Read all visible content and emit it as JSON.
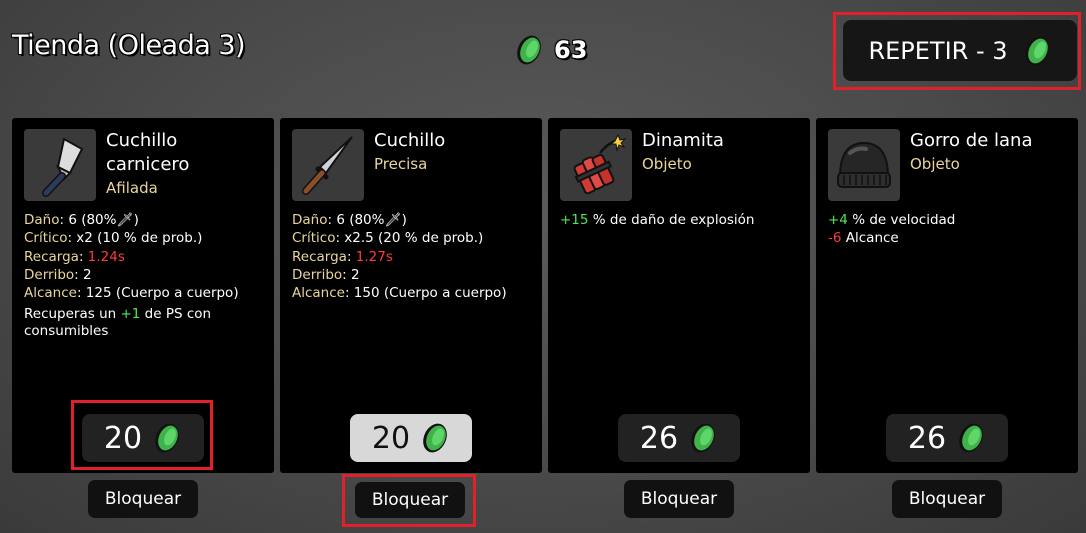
{
  "header": {
    "title": "Tienda (Oleada 3)",
    "materials": "63",
    "reroll_label": "REPETIR - 3"
  },
  "cards": [
    {
      "name": "Cuchillo carnicero",
      "tag": "Afilada",
      "icon": "cleaver-icon",
      "stats": [
        {
          "key": "Daño",
          "value": ": 6 (80%",
          "suffix": ")",
          "icon": "sword-icon"
        },
        {
          "key": "Crítico",
          "value": ": x2 (10 % de prob.)"
        },
        {
          "key": "Recarga",
          "value": ": ",
          "red": "1.24s"
        },
        {
          "key": "Derribo",
          "value": ": 2"
        },
        {
          "key": "Alcance",
          "value": ": 125 (Cuerpo a cuerpo)"
        }
      ],
      "extra_pre": "Recuperas un ",
      "extra_green": "+1",
      "extra_post": " de PS con consumibles",
      "price": "20",
      "lock_label": "Bloquear"
    },
    {
      "name": "Cuchillo",
      "tag": "Precisa",
      "icon": "knife-icon",
      "stats": [
        {
          "key": "Daño",
          "value": ": 6 (80%",
          "suffix": ")",
          "icon": "sword-icon"
        },
        {
          "key": "Crítico",
          "value": ": x2.5 (20 % de prob.)"
        },
        {
          "key": "Recarga",
          "value": ": ",
          "red": "1.27s"
        },
        {
          "key": "Derribo",
          "value": ": 2"
        },
        {
          "key": "Alcance",
          "value": ": 150 (Cuerpo a cuerpo)"
        }
      ],
      "price": "20",
      "lock_label": "Bloquear"
    },
    {
      "name": "Dinamita",
      "tag": "Objeto",
      "icon": "dynamite-icon",
      "effects": [
        {
          "green": "+15",
          "text": " % de daño de explosión"
        }
      ],
      "price": "26",
      "lock_label": "Bloquear"
    },
    {
      "name": "Gorro de lana",
      "tag": "Objeto",
      "icon": "beanie-icon",
      "effects": [
        {
          "green": "+4",
          "text": " % de velocidad"
        },
        {
          "red": "-6",
          "text": " Alcance"
        }
      ],
      "price": "26",
      "lock_label": "Bloquear"
    }
  ],
  "colors": {
    "accent_highlight": "#e0202a",
    "tag": "#e8d69a",
    "positive": "#4ee84e",
    "negative": "#ff3b3b",
    "coin": "#3fb24a"
  }
}
